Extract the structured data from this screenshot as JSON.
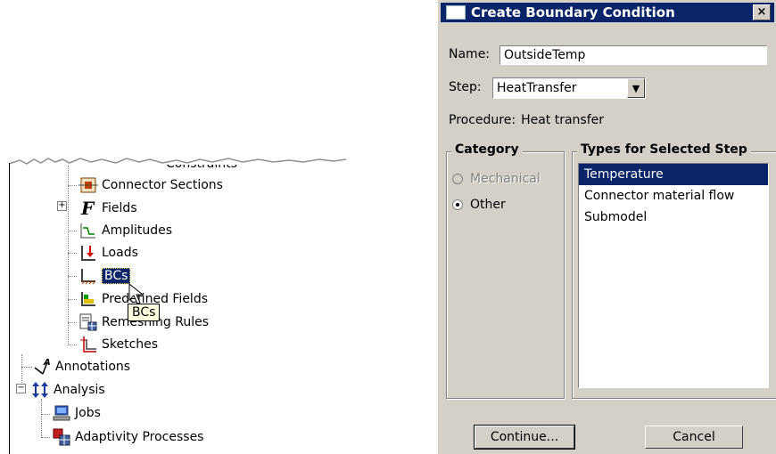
{
  "tree": {
    "items": [
      {
        "label": "Constraints",
        "icon": "constraints-icon"
      },
      {
        "label": "Connector Sections",
        "icon": "connector-sections-icon"
      },
      {
        "label": "Fields",
        "icon": "fields-icon",
        "expander": "+"
      },
      {
        "label": "Amplitudes",
        "icon": "amplitudes-icon"
      },
      {
        "label": "Loads",
        "icon": "loads-icon"
      },
      {
        "label": "BCs",
        "icon": "bcs-icon",
        "selected": true
      },
      {
        "label": "Predefined Fields",
        "icon": "predefined-fields-icon"
      },
      {
        "label": "Remeshing Rules",
        "icon": "remeshing-rules-icon"
      },
      {
        "label": "Sketches",
        "icon": "sketches-icon"
      },
      {
        "label": "Annotations",
        "icon": "annotations-icon"
      },
      {
        "label": "Analysis",
        "icon": "analysis-icon",
        "expander": "−"
      },
      {
        "label": "Jobs",
        "icon": "jobs-icon"
      },
      {
        "label": "Adaptivity Processes",
        "icon": "adaptivity-processes-icon"
      }
    ],
    "tooltip": "BCs"
  },
  "dialog": {
    "title": "Create Boundary Condition",
    "close_label": "×",
    "name_label": "Name:",
    "name_value": "OutsideTemp",
    "step_label": "Step:",
    "step_value": "HeatTransfer",
    "procedure_label": "Procedure:",
    "procedure_value": "Heat transfer",
    "category_title": "Category",
    "category_options": [
      {
        "label": "Mechanical",
        "checked": false,
        "disabled": true
      },
      {
        "label": "Other",
        "checked": true,
        "disabled": false
      }
    ],
    "types_title": "Types for Selected Step",
    "types": [
      {
        "label": "Temperature",
        "selected": true
      },
      {
        "label": "Connector material flow",
        "selected": false
      },
      {
        "label": "Submodel",
        "selected": false
      }
    ],
    "continue_label": "Continue...",
    "cancel_label": "Cancel"
  },
  "colors": {
    "selection": "#0a246a",
    "dialog_bg": "#d4d0c8",
    "tooltip_bg": "#ffffe1"
  }
}
